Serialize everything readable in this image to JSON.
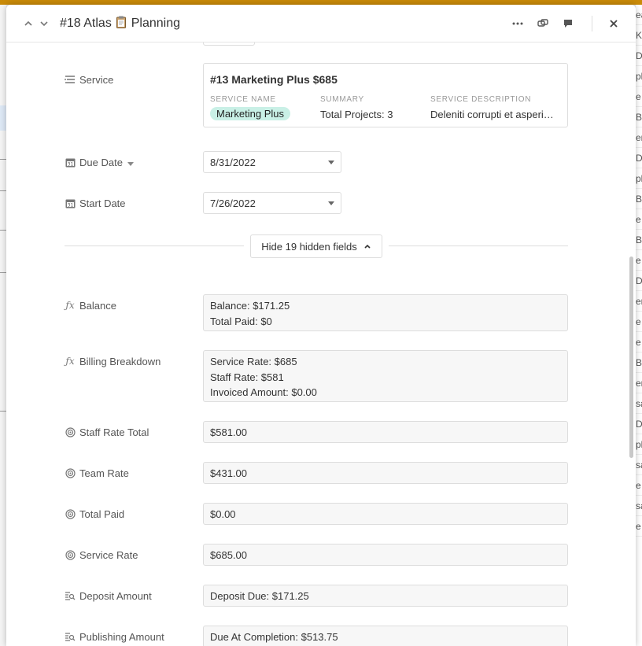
{
  "modal": {
    "title_prefix": "#18 Atlas",
    "title_suffix": "Planning"
  },
  "fields": {
    "service": {
      "label": "Service",
      "card_title": "#13 Marketing Plus $685",
      "service_name_caption": "SERVICE NAME",
      "service_name": "Marketing Plus",
      "summary_caption": "SUMMARY",
      "summary": "Total Projects: 3",
      "description_caption": "SERVICE DESCRIPTION",
      "description": "Deleniti corrupti et asperi…"
    },
    "due_date": {
      "label": "Due Date",
      "value": "8/31/2022"
    },
    "start_date": {
      "label": "Start Date",
      "value": "7/26/2022"
    },
    "hide_button": "Hide 19 hidden fields",
    "balance": {
      "label": "Balance",
      "line1": "Balance: $171.25",
      "line2": "Total Paid: $0"
    },
    "billing_breakdown": {
      "label": "Billing Breakdown",
      "line1": "Service Rate: $685",
      "line2": "Staff Rate: $581",
      "line3": "Invoiced Amount: $0.00"
    },
    "staff_rate_total": {
      "label": "Staff Rate Total",
      "value": "$581.00"
    },
    "team_rate": {
      "label": "Team Rate",
      "value": "$431.00"
    },
    "total_paid": {
      "label": "Total Paid",
      "value": "$0.00"
    },
    "service_rate": {
      "label": "Service Rate",
      "value": "$685.00"
    },
    "deposit_amount": {
      "label": "Deposit Amount",
      "value": "Deposit Due: $171.25"
    },
    "publishing_amount": {
      "label": "Publishing Amount",
      "value": "Due At Completion: $513.75"
    }
  },
  "background": {
    "right_snippets": [
      "ea",
      "K",
      "Dr",
      "pl",
      "e",
      "B",
      "er",
      "Dr",
      "pl",
      "B",
      "e",
      "B",
      "e",
      "Dr",
      "er",
      "e",
      "e",
      "B",
      "er",
      "sa",
      "Dr",
      "pl",
      "sa",
      "e",
      "sa",
      "e"
    ]
  },
  "colors": {
    "accent_bar": "#c98a08",
    "pill_bg": "#c9f0e6"
  }
}
